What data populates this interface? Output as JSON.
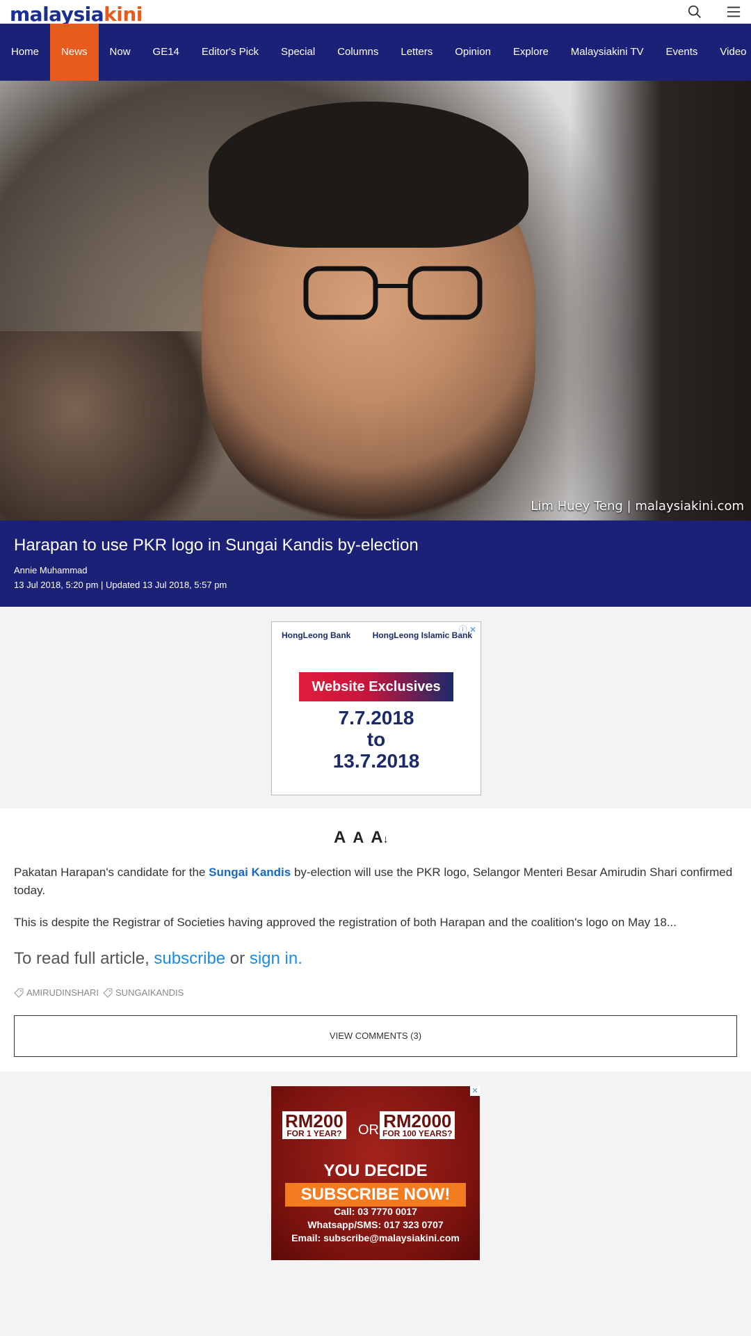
{
  "brand": {
    "logo_part1": "malaysia",
    "logo_part2": "kini"
  },
  "nav": {
    "items": [
      {
        "label": "Home"
      },
      {
        "label": "News"
      },
      {
        "label": "Now"
      },
      {
        "label": "GE14"
      },
      {
        "label": "Editor's Pick"
      },
      {
        "label": "Special"
      },
      {
        "label": "Columns"
      },
      {
        "label": "Letters"
      },
      {
        "label": "Opinion"
      },
      {
        "label": "Explore"
      },
      {
        "label": "Malaysiakini TV"
      },
      {
        "label": "Events"
      },
      {
        "label": "Video"
      }
    ],
    "active_index": 1
  },
  "hero": {
    "credit": "Lim Huey Teng | malaysiakini.com"
  },
  "article": {
    "headline": "Harapan to use PKR logo in Sungai Kandis by-election",
    "author": "Annie Muhammad",
    "published": "13 Jul 2018, 5:20 pm",
    "updated_label": "Updated",
    "updated": "13 Jul 2018, 5:57 pm",
    "p1_before": "Pakatan Harapan's candidate for the ",
    "p1_link": "Sungai Kandis",
    "p1_after": " by-election will use the PKR logo, Selangor Menteri Besar Amirudin Shari confirmed today.",
    "p2": "This is despite the Registrar of Societies having approved the registration of both Harapan and the coalition's logo on May 18...",
    "readfull_prefix": "To read full article, ",
    "subscribe": "subscribe",
    "or": " or ",
    "signin": "sign in.",
    "tags": [
      "AMIRUDINSHARI",
      "SUNGAIKANDIS"
    ],
    "comments_button": "VIEW COMMENTS (3)"
  },
  "font_controls": {
    "big": "A",
    "small": "A",
    "reset": "A"
  },
  "ad1": {
    "bank1": "HongLeong Bank",
    "bank2": "HongLeong Islamic Bank",
    "headline": "Website Exclusives",
    "date1": "7.7.2018",
    "to": "to",
    "date2": "13.7.2018"
  },
  "ad2": {
    "rm1": "RM200",
    "rm1_sub": "FOR 1 YEAR?",
    "or": "OR",
    "rm2": "RM2000",
    "rm2_sub": "FOR 100 YEARS?",
    "decide": "YOU DECIDE",
    "subscribe": "SUBSCRIBE NOW!",
    "call": "Call: 03 7770 0017",
    "whatsapp": "Whatsapp/SMS: 017 323 0707",
    "email": "Email: subscribe@malaysiakini.com"
  },
  "colors": {
    "brand_blue": "#1b2177",
    "brand_orange": "#e85b1f",
    "link_blue": "#1a66c9"
  }
}
